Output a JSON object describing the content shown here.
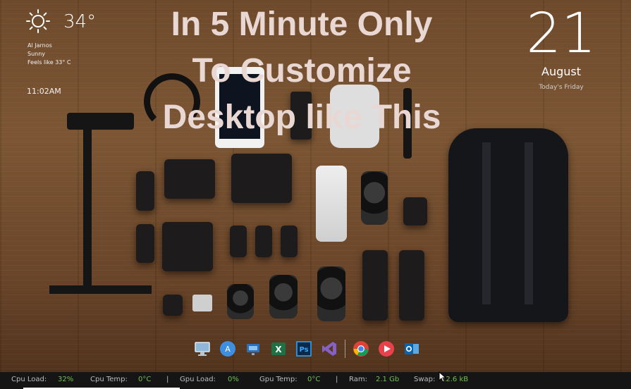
{
  "weather": {
    "temperature": "34°",
    "location": "Al Jarnos",
    "condition": "Sunny",
    "feels_like": "Feels like 33° C",
    "icon": "sun-icon"
  },
  "clock": {
    "time": "11:02AM"
  },
  "headline": {
    "line1": "In 5 Minute Only",
    "line2": "To Customize",
    "line3": "Desktop like This"
  },
  "date": {
    "day": "21",
    "month": "August",
    "weekday_text": "Today's Friday"
  },
  "dock": {
    "items": [
      {
        "name": "computer-icon"
      },
      {
        "name": "app-store-icon"
      },
      {
        "name": "network-folder-icon"
      },
      {
        "name": "excel-icon"
      },
      {
        "name": "photoshop-icon"
      },
      {
        "name": "visual-studio-icon"
      },
      {
        "name": "chrome-icon"
      },
      {
        "name": "media-player-icon"
      },
      {
        "name": "outlook-icon"
      }
    ]
  },
  "stats": {
    "cpu_load_label": "Cpu Load:",
    "cpu_load_value": "32%",
    "cpu_temp_label": "Cpu Temp:",
    "cpu_temp_value": "0°C",
    "gpu_load_label": "Gpu Load:",
    "gpu_load_value": "0%",
    "gpu_temp_label": "Gpu Temp:",
    "gpu_temp_value": "0°C",
    "ram_label": "Ram:",
    "ram_value": "2.1 Gb",
    "swap_label": "Swap:",
    "swap_value": "12.6 kB",
    "separator": "|"
  },
  "colors": {
    "stat_value": "#6ec24a",
    "headline": "#e9d7d3",
    "taskbar": "#151515"
  }
}
